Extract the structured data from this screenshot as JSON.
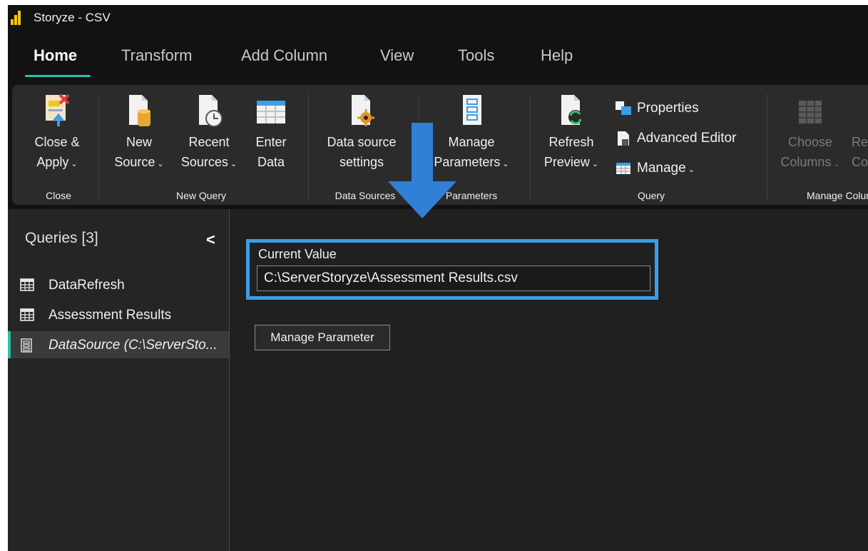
{
  "window": {
    "title": "Storyze - CSV"
  },
  "tabs": [
    {
      "label": "Home",
      "active": true
    },
    {
      "label": "Transform"
    },
    {
      "label": "Add Column"
    },
    {
      "label": "View"
    },
    {
      "label": "Tools"
    },
    {
      "label": "Help"
    }
  ],
  "ribbon": {
    "close_group": {
      "label": "Close",
      "close_apply": [
        "Close &",
        "Apply"
      ]
    },
    "new_query_group": {
      "label": "New Query",
      "new_source": [
        "New",
        "Source"
      ],
      "recent_sources": [
        "Recent",
        "Sources"
      ],
      "enter_data": [
        "Enter",
        "Data"
      ]
    },
    "data_sources_group": {
      "label": "Data Sources",
      "settings": [
        "Data source",
        "settings"
      ]
    },
    "parameters_group": {
      "label": "Parameters",
      "manage": [
        "Manage",
        "Parameters"
      ]
    },
    "query_group": {
      "label": "Query",
      "refresh": [
        "Refresh",
        "Preview"
      ],
      "properties": "Properties",
      "advanced_editor": "Advanced Editor",
      "manage": "Manage"
    },
    "manage_columns_group": {
      "label": "Manage Columns",
      "choose": [
        "Choose",
        "Columns"
      ],
      "remove": [
        "Remove",
        "Columns"
      ]
    }
  },
  "queries": {
    "title": "Queries [3]",
    "items": [
      {
        "label": "DataRefresh",
        "icon": "table-icon"
      },
      {
        "label": "Assessment Results",
        "icon": "table-icon"
      },
      {
        "label": "DataSource (C:\\ServerSto...",
        "icon": "parameter-icon",
        "selected": true
      }
    ]
  },
  "parameter": {
    "current_value_label": "Current Value",
    "current_value": "C:\\ServerStoryze\\Assessment Results.csv",
    "manage_button": "Manage Parameter"
  },
  "colors": {
    "accent": "#2dbfa8",
    "highlight": "#3b9ee6",
    "brand": "#f2c811"
  }
}
